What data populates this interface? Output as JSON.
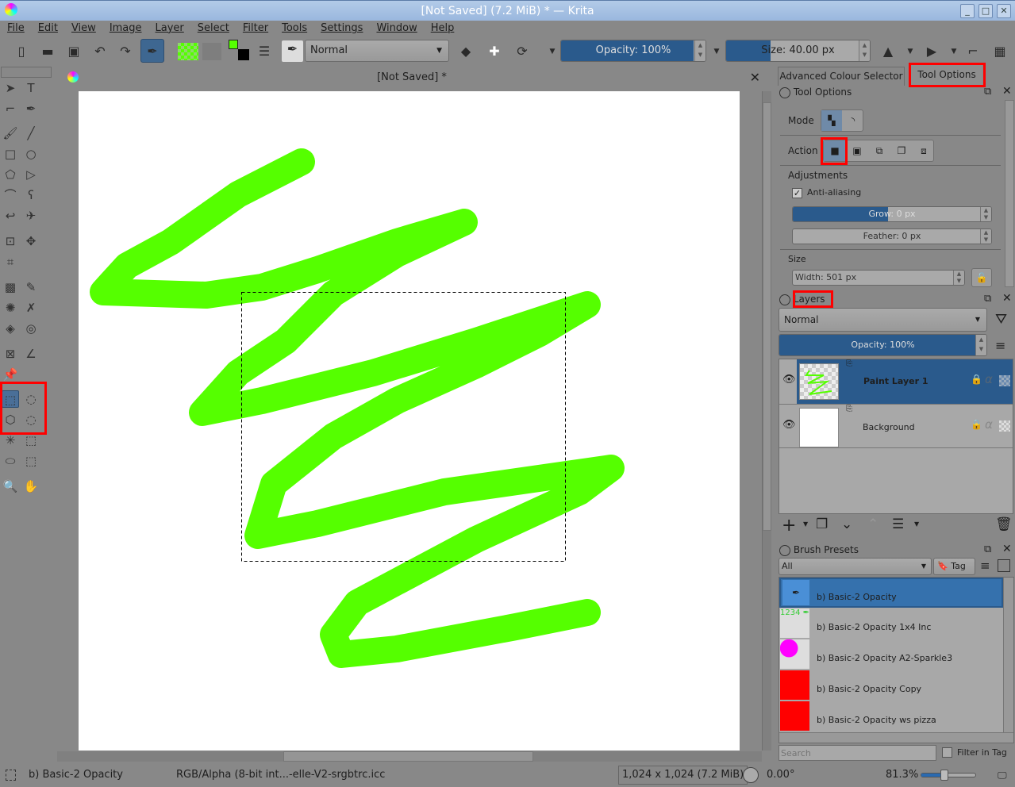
{
  "window": {
    "title": "[Not Saved]  (7.2 MiB)  * — Krita"
  },
  "menu": [
    "File",
    "Edit",
    "View",
    "Image",
    "Layer",
    "Select",
    "Filter",
    "Tools",
    "Settings",
    "Window",
    "Help"
  ],
  "toolbar": {
    "blend_mode": "Normal",
    "opacity": "Opacity: 100%",
    "opacity_value": 100,
    "size": "Size: 40.00 px",
    "size_fraction": 0.35,
    "fg_color": "#55ff00",
    "bg_color": "#000000"
  },
  "document": {
    "tab_title": "[Not Saved]  *",
    "stroke_color": "#55ff00"
  },
  "dock_tabs": {
    "colour_selector": "Advanced Colour Selector",
    "tool_options": "Tool Options"
  },
  "tool_options": {
    "title": "Tool Options",
    "mode_label": "Mode",
    "action_label": "Action",
    "adjustments_label": "Adjustments",
    "anti_aliasing": "Anti-aliasing",
    "anti_aliasing_checked": true,
    "grow": "Grow: 0 px",
    "feather": "Feather: 0 px",
    "size_label": "Size",
    "width": "Width: 501 px"
  },
  "layers": {
    "title": "Layers",
    "blend_mode": "Normal",
    "opacity": "Opacity:  100%",
    "items": [
      {
        "name": "Paint Layer 1",
        "selected": true
      },
      {
        "name": "Background",
        "selected": false
      }
    ]
  },
  "brush_presets": {
    "title": "Brush Presets",
    "filter": "All",
    "tag_label": "Tag",
    "items": [
      "b) Basic-2 Opacity",
      "b) Basic-2 Opacity 1x4 Inc",
      "b) Basic-2 Opacity A2-Sparkle3",
      "b) Basic-2 Opacity Copy",
      "b) Basic-2 Opacity ws pizza"
    ],
    "search_placeholder": "Search",
    "filter_in_tag": "Filter in Tag"
  },
  "status": {
    "brush": "b) Basic-2 Opacity",
    "color_profile": "RGB/Alpha (8-bit int...-elle-V2-srgbtrc.icc",
    "dimensions": "1,024 x 1,024 (7.2 MiB)",
    "rotation": "0.00°",
    "zoom": "81.3%",
    "zoom_fraction": 0.4
  }
}
